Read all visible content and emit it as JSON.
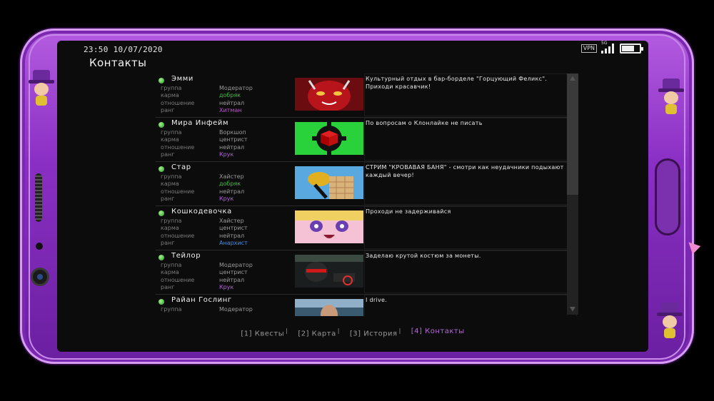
{
  "status_bar": {
    "time": "23:50",
    "date": "10/07/2020",
    "vpn": "VPN",
    "network": "5G",
    "battery_level": 0.7
  },
  "page": {
    "title": "Контакты"
  },
  "field_labels": {
    "group": "группа",
    "karma": "карма",
    "relation": "отношение",
    "rank": "ранг"
  },
  "colors": {
    "karma_good": "#3fbf3f",
    "rank_crook": "#b464e0",
    "rank_hitman": "#c44fd9",
    "rank_anarchist": "#3f8fe0",
    "active_tab": "#b46ad8"
  },
  "contacts": [
    {
      "name": "Эмми",
      "group": "Модератор",
      "karma": "добряк",
      "relation": "нейтрал",
      "rank": "Хитман",
      "status": "Культурный отдых в бар-борделе \"Горцующий Феликс\". Приходи красавчик!",
      "avatar": "red-demon-girl-avatar"
    },
    {
      "name": "Мира Инфейм",
      "group": "Воркшоп",
      "karma": "центрист",
      "relation": "нейтрал",
      "rank": "Крук",
      "status": "По вопросам о Клонлайке не писать",
      "avatar": "gear-cube-avatar"
    },
    {
      "name": "Стар",
      "group": "Хайстер",
      "karma": "добряк",
      "relation": "нейтрал",
      "rank": "Крук",
      "status": "СТРИМ \"КРОВАВАЯ БАНЯ\" - смотри как неудачники подыхают каждый вечер!",
      "avatar": "dog-meme-avatar"
    },
    {
      "name": "Кошкодевочка",
      "group": "Хайстер",
      "karma": "центрист",
      "relation": "нейтрал",
      "rank": "Анархист",
      "status": "Проходи не задерживайся",
      "avatar": "anime-catgirl-avatar"
    },
    {
      "name": "Тейлор",
      "group": "Модератор",
      "karma": "центрист",
      "relation": "нейтрал",
      "rank": "Крук",
      "status": "Заделаю крутой костюм за монеты.",
      "avatar": "dark-armor-avatar"
    },
    {
      "name": "Райан Гослинг",
      "group": "Модератор",
      "karma": "",
      "relation": "",
      "rank": "",
      "status": "I drive.",
      "avatar": "driver-avatar"
    }
  ],
  "nav": [
    {
      "key": "[1]",
      "label": "Квесты"
    },
    {
      "key": "[2]",
      "label": "Карта"
    },
    {
      "key": "[3]",
      "label": "История"
    },
    {
      "key": "[4]",
      "label": "Контакты",
      "active": true
    }
  ]
}
